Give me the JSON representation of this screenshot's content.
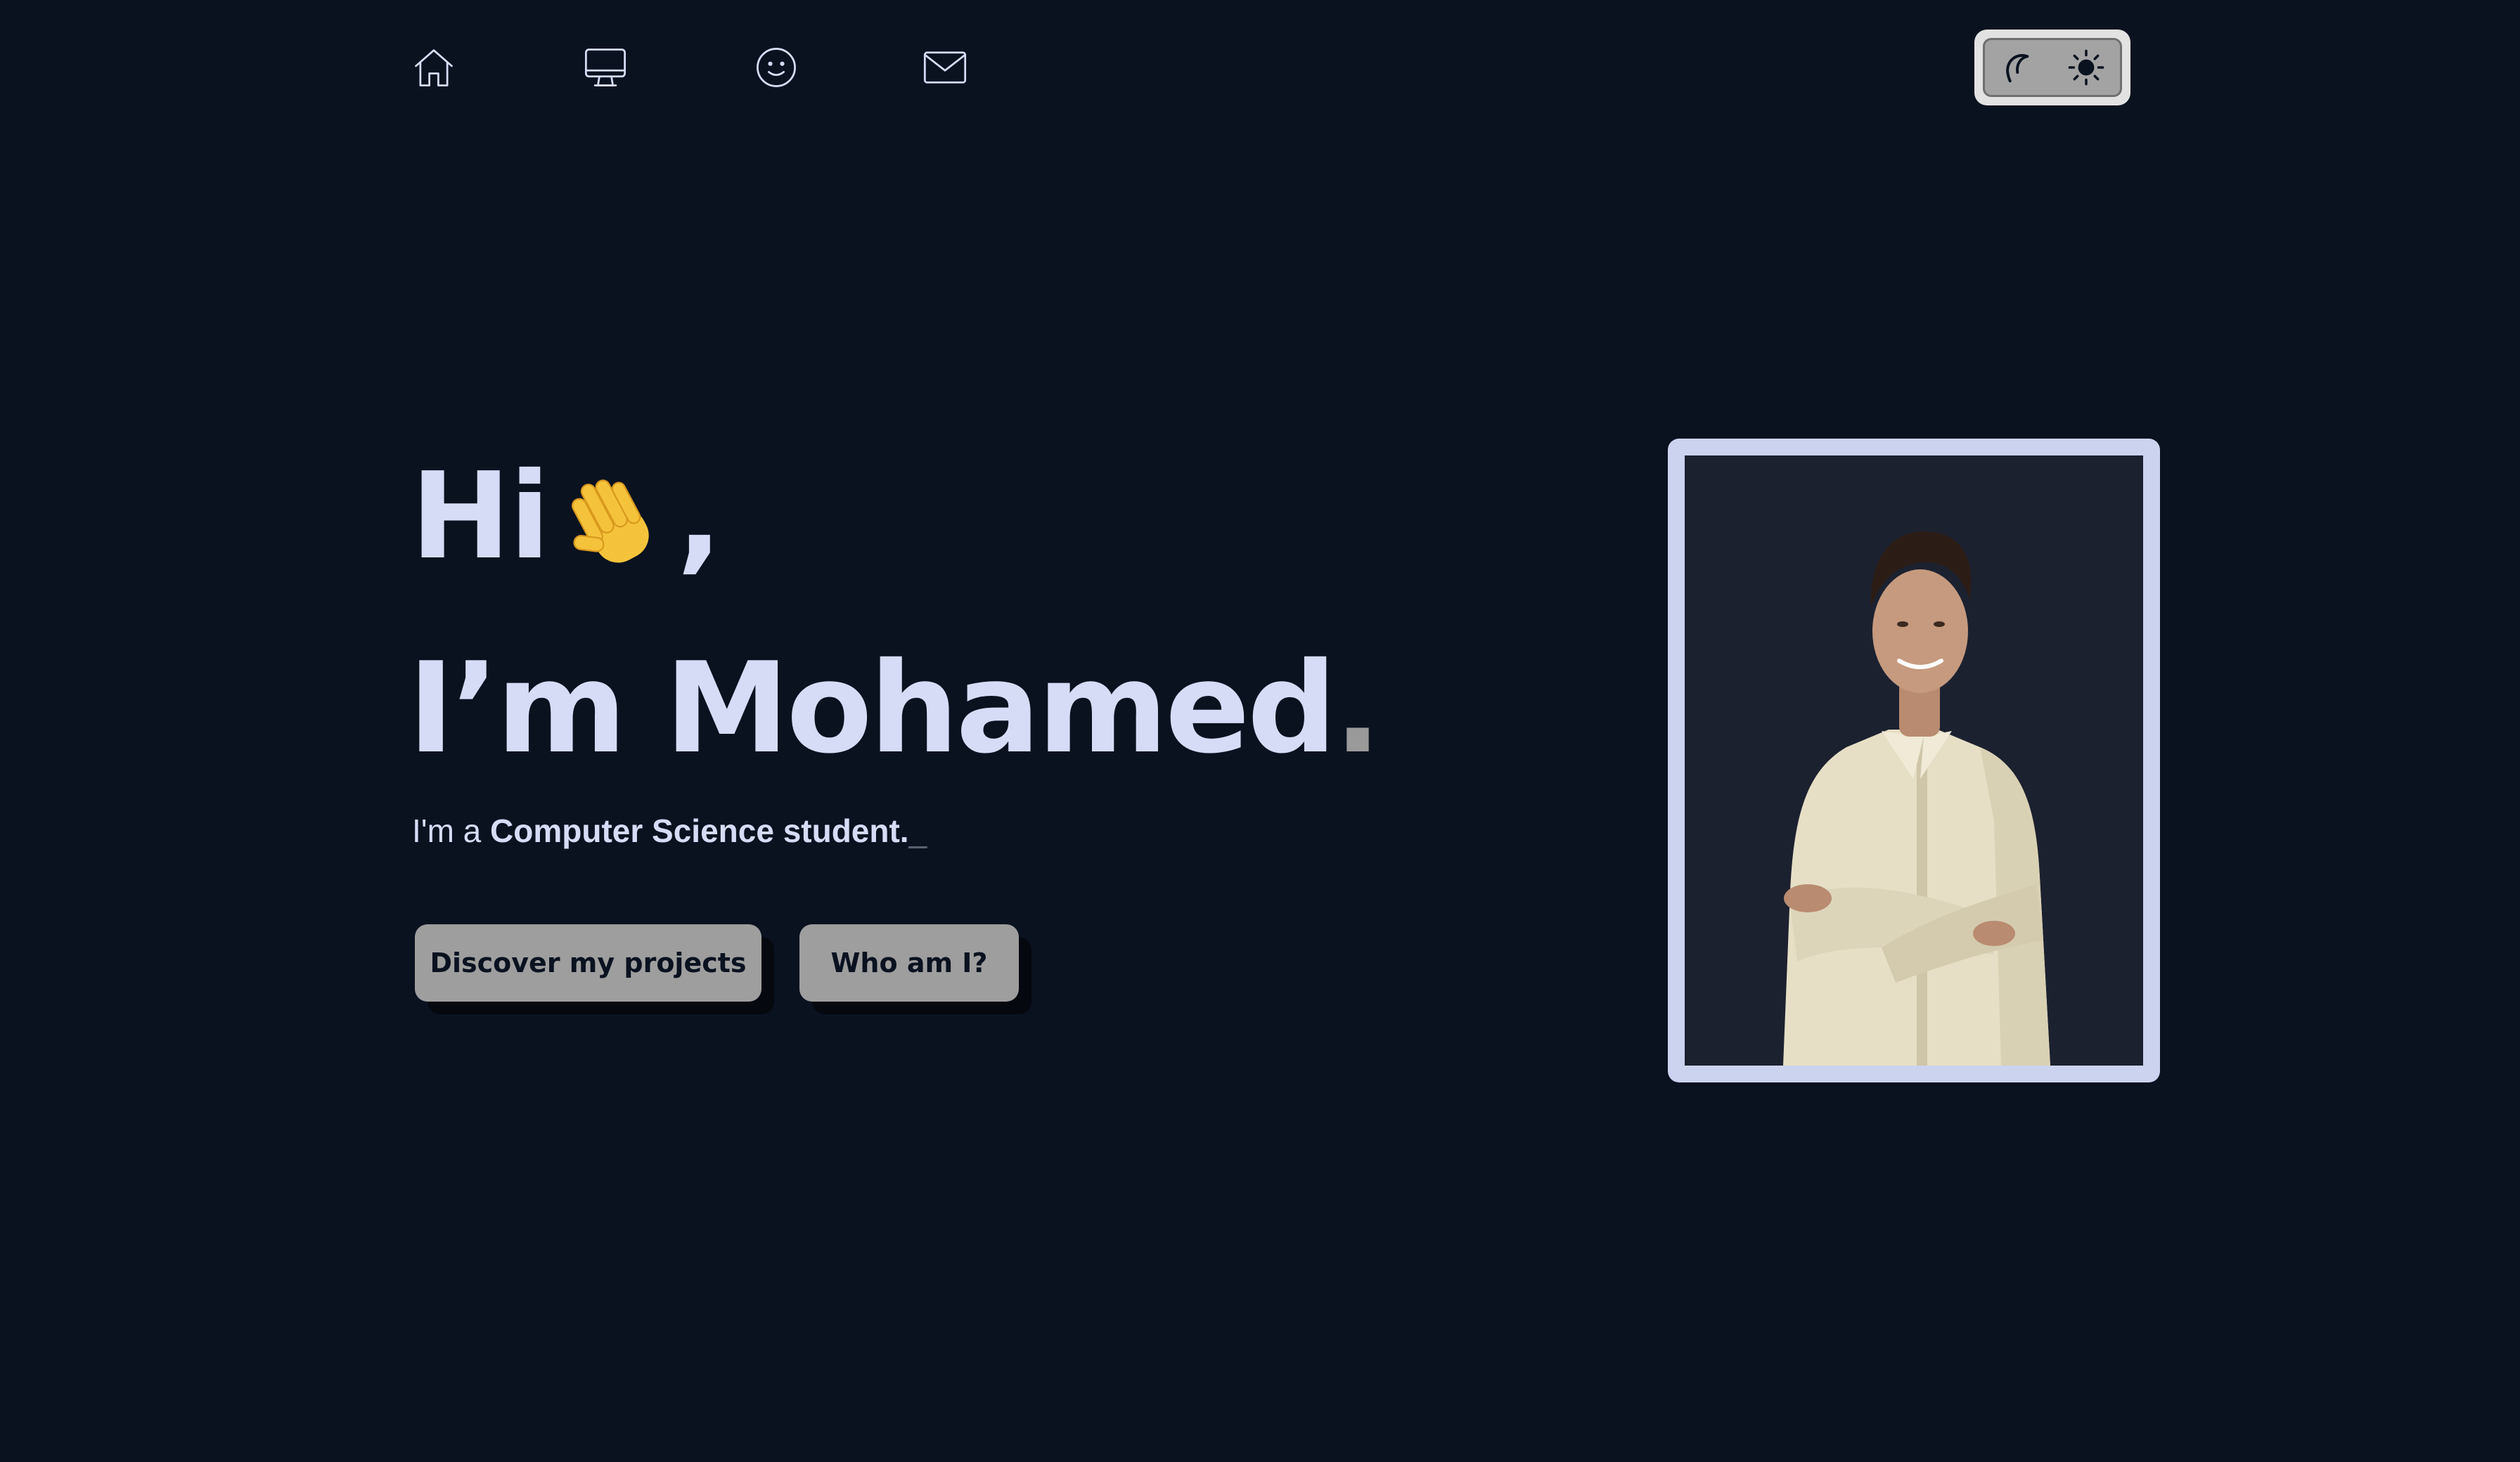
{
  "nav": {
    "items": [
      {
        "id": "home",
        "icon": "home-icon"
      },
      {
        "id": "projects",
        "icon": "monitor-icon"
      },
      {
        "id": "about",
        "icon": "smiley-icon"
      },
      {
        "id": "contact",
        "icon": "mail-icon"
      }
    ]
  },
  "theme_toggle": {
    "dark_icon": "moon-icon",
    "light_icon": "sun-icon"
  },
  "hero": {
    "greeting_word": "Hi",
    "greeting_emoji": "waving-hand-emoji",
    "greeting_punct": ",",
    "headline": "I’m Mohamed",
    "headline_dot": ".",
    "tagline_prefix": "I'm a ",
    "tagline_role": "Computer Science student.",
    "tagline_cursor": "_"
  },
  "buttons": {
    "projects_label": "Discover my projects",
    "about_label": "Who am I?"
  },
  "portrait": {
    "image": "portrait-photo"
  },
  "colors": {
    "background": "#0a1220",
    "text": "#d6dcf5",
    "button": "#9e9e9e",
    "frame": "#ccd3ef",
    "accent_dot": "#9a9a9a"
  }
}
